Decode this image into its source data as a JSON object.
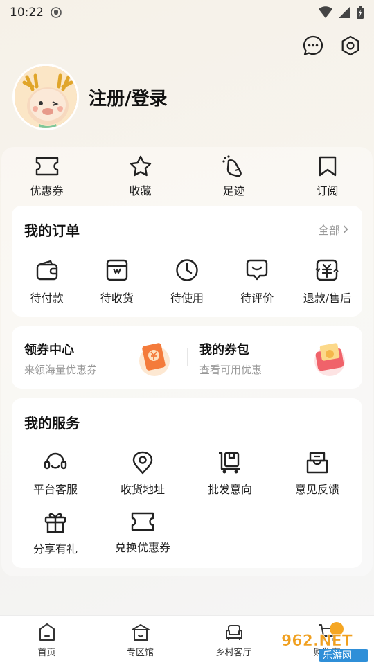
{
  "status_bar": {
    "time": "10:22"
  },
  "profile": {
    "login_text": "注册/登录"
  },
  "quick_actions": [
    {
      "label": "优惠券",
      "icon": "ticket-icon"
    },
    {
      "label": "收藏",
      "icon": "star-icon"
    },
    {
      "label": "足迹",
      "icon": "footprint-icon"
    },
    {
      "label": "订阅",
      "icon": "bookmark-icon"
    }
  ],
  "orders": {
    "title": "我的订单",
    "all_link": "全部",
    "items": [
      {
        "label": "待付款",
        "icon": "wallet-icon"
      },
      {
        "label": "待收货",
        "icon": "package-icon"
      },
      {
        "label": "待使用",
        "icon": "clock-icon"
      },
      {
        "label": "待评价",
        "icon": "review-icon"
      },
      {
        "label": "退款/售后",
        "icon": "refund-icon"
      }
    ]
  },
  "coupons": {
    "center": {
      "title": "领券中心",
      "subtitle": "来领海量优惠券"
    },
    "wallet": {
      "title": "我的券包",
      "subtitle": "查看可用优惠"
    }
  },
  "services": {
    "title": "我的服务",
    "items": [
      {
        "label": "平台客服",
        "icon": "headset-icon"
      },
      {
        "label": "收货地址",
        "icon": "location-icon"
      },
      {
        "label": "批发意向",
        "icon": "cart-box-icon"
      },
      {
        "label": "意见反馈",
        "icon": "feedback-icon"
      },
      {
        "label": "分享有礼",
        "icon": "gift-icon"
      },
      {
        "label": "兑换优惠券",
        "icon": "ticket-icon"
      }
    ]
  },
  "tabbar": [
    {
      "label": "首页",
      "icon": "home-icon"
    },
    {
      "label": "专区馆",
      "icon": "pavilion-icon"
    },
    {
      "label": "乡村客厅",
      "icon": "sofa-icon"
    },
    {
      "label": "购物车",
      "icon": "cart-icon"
    }
  ],
  "watermark": {
    "text_top": "962.NET",
    "text_bottom": "乐游网"
  },
  "colors": {
    "accent": "#f5a623",
    "card_bg": "#ffffff",
    "muted": "#999999"
  }
}
